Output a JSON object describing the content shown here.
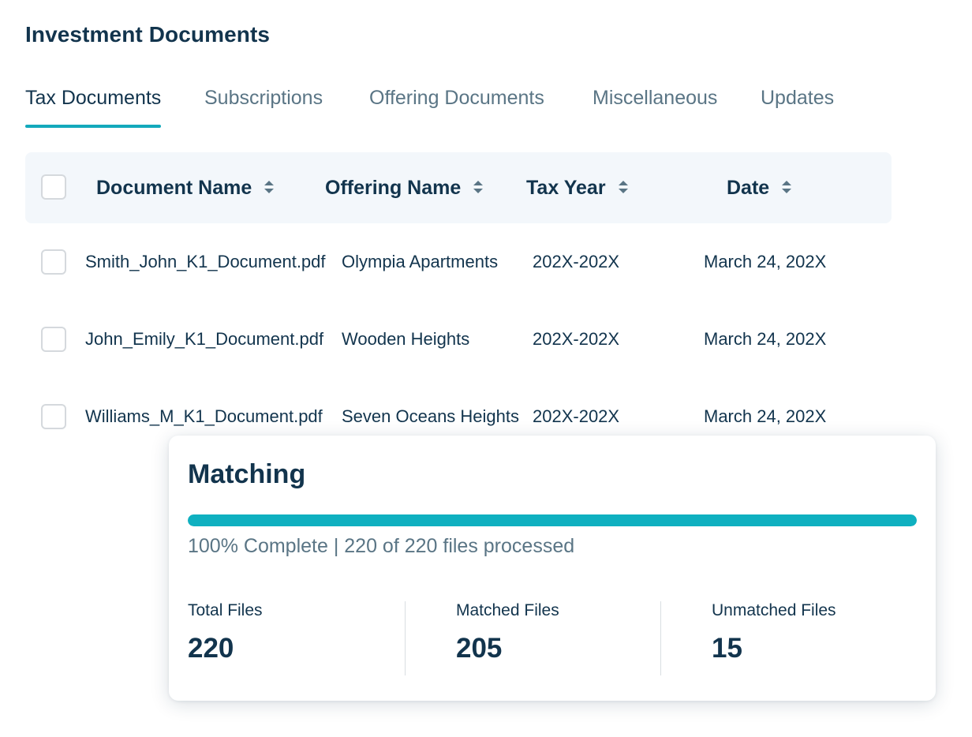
{
  "page": {
    "title": "Investment Documents"
  },
  "tabs": [
    {
      "label": "Tax Documents",
      "active": true
    },
    {
      "label": "Subscriptions",
      "active": false
    },
    {
      "label": "Offering Documents",
      "active": false
    },
    {
      "label": "Miscellaneous",
      "active": false
    },
    {
      "label": "Updates",
      "active": false
    }
  ],
  "table": {
    "columns": [
      "Document Name",
      "Offering Name",
      "Tax Year",
      "Date"
    ],
    "rows": [
      {
        "document": "Smith_John_K1_Document.pdf",
        "offering": "Olympia Apartments",
        "tax_year": "202X-202X",
        "date": "March 24, 202X"
      },
      {
        "document": "John_Emily_K1_Document.pdf",
        "offering": "Wooden Heights",
        "tax_year": "202X-202X",
        "date": "March 24, 202X"
      },
      {
        "document": "Williams_M_K1_Document.pdf",
        "offering": "Seven Oceans Heights",
        "tax_year": "202X-202X",
        "date": "March 24, 202X"
      }
    ]
  },
  "matching": {
    "title": "Matching",
    "progress_percent": 100,
    "progress_text": "100% Complete | 220 of 220 files processed",
    "stats": [
      {
        "label": "Total Files",
        "value": "220"
      },
      {
        "label": "Matched Files",
        "value": "205"
      },
      {
        "label": "Unmatched Files",
        "value": "15"
      }
    ]
  },
  "colors": {
    "accent": "#13a9bc",
    "text_primary": "#12344d",
    "text_secondary": "#5a7585",
    "header_bg": "#f3f7fb"
  }
}
